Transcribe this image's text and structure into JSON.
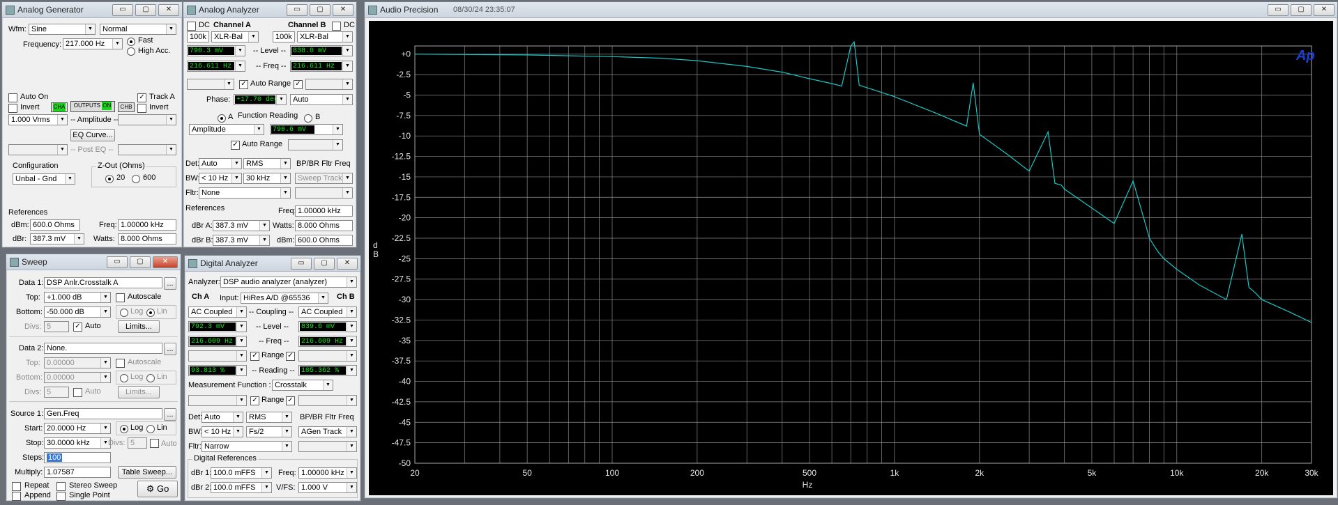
{
  "gen": {
    "title": "Analog Generator",
    "wfm_label": "Wfm:",
    "wfm": "Sine",
    "mode": "Normal",
    "freq_label": "Frequency:",
    "freq": "217.000  Hz",
    "fast": "Fast",
    "high_acc": "High Acc.",
    "auto_on": "Auto On",
    "invert": "Invert",
    "track_a": "Track A",
    "invert_b": "Invert",
    "cha": "CHA",
    "outputs": "OUTPUTS",
    "on": "ON",
    "chb": "CHB",
    "amp_val": "1.000    Vrms",
    "amp_label": "-- Amplitude --",
    "eq_curve": "EQ Curve...",
    "post_eq": "-- Post EQ --",
    "config_label": "Configuration",
    "config": "Unbal - Gnd",
    "zout_label": "Z-Out (Ohms)",
    "z20": "20",
    "z600": "600",
    "refs": "References",
    "dbm_label": "dBm:",
    "dbm": "600.0    Ohms",
    "dbr_label": "dBr:",
    "dbr": "387.3   mV",
    "freq_ref_label": "Freq:",
    "freq_ref": "1.00000 kHz",
    "watts_label": "Watts:",
    "watts": "8.000    Ohms"
  },
  "ana": {
    "title": "Analog Analyzer",
    "dc": "DC",
    "cha": "Channel A",
    "chb": "Channel B",
    "dc2": "DC",
    "za": "100k",
    "ina": "XLR-Bal",
    "zb": "100k",
    "inb": "XLR-Bal",
    "lev_a": "790.3   mV",
    "lev_label": "-- Level --",
    "lev_b": "838.0   mV",
    "freq_a": "216.611  Hz",
    "freq_label": "-- Freq --",
    "freq_b": "216.611  Hz",
    "auto_range": "Auto Range",
    "phase_label": "Phase:",
    "phase": "+17.70  deg",
    "phase_mode": "Auto",
    "fr_a": "A",
    "fr_label": "Function Reading",
    "fr_b": "B",
    "fn": "Amplitude",
    "fn_val": "790.6   mV",
    "auto_range2": "Auto Range",
    "det_label": "Det:",
    "det": "Auto",
    "rms": "RMS",
    "bp": "BP/BR Fltr Freq",
    "bw_label": "BW:",
    "bw": "< 10 Hz",
    "bw2": "30 kHz",
    "sweep_track": "Sweep Track",
    "fltr_label": "Fltr:",
    "fltr": "None",
    "refs": "References",
    "freq_ref_label": "Freq:",
    "freq_ref": "1.00000 kHz",
    "dbra_label": "dBr A:",
    "dbra": "387.3   mV",
    "watts_label": "Watts:",
    "watts": "8.000    Ohms",
    "dbrb_label": "dBr B:",
    "dbrb": "387.3   mV",
    "dbm_label": "dBm:",
    "dbm": "600.0    Ohms"
  },
  "sweep": {
    "title": "Sweep",
    "data1_label": "Data 1:",
    "data1": "DSP Anlr.Crosstalk A",
    "top_label": "Top:",
    "top": "+1.000   dB",
    "autoscale": "Autoscale",
    "bottom_label": "Bottom:",
    "bottom": "-50.000  dB",
    "log": "Log",
    "lin": "Lin",
    "divs_label": "Divs:",
    "divs": "5",
    "auto": "Auto",
    "limits": "Limits...",
    "data2_label": "Data 2:",
    "data2": "None.",
    "top2": "0.00000",
    "bottom2": "0.00000",
    "divs2": "5",
    "limits2": "Limits...",
    "source_label": "Source 1:",
    "source": "Gen.Freq",
    "start_label": "Start:",
    "start": "20.0000  Hz",
    "stop_label": "Stop:",
    "stop": "30.0000 kHz",
    "divs3": "5",
    "steps_label": "Steps:",
    "steps": "100",
    "multiply_label": "Multiply:",
    "multiply": "1.07587",
    "table_sweep": "Table Sweep...",
    "repeat": "Repeat",
    "stereo": "Stereo Sweep",
    "append": "Append",
    "single": "Single Point",
    "go": "Go"
  },
  "dig": {
    "title": "Digital Analyzer",
    "analyzer_label": "Analyzer:",
    "analyzer": "DSP audio analyzer (analyzer)",
    "cha": "Ch A",
    "input_label": "Input:",
    "input": "HiRes A/D @65536",
    "chb": "Ch B",
    "coup_a": "AC Coupled",
    "coup_label": "-- Coupling --",
    "coup_b": "AC Coupled",
    "lev_a": "792.3   mV",
    "lev_label": "-- Level --",
    "lev_b": "839.6   mV",
    "freq_a": "216.609  Hz",
    "freq_label": "-- Freq --",
    "freq_b": "216.609  Hz",
    "range": "Range",
    "read_a": "93.813   %",
    "read_label": "-- Reading --",
    "read_b": "105.362  %",
    "mf_label": "Measurement Function :",
    "mf": "Crosstalk",
    "range2": "Range",
    "det_label": "Det:",
    "det": "Auto",
    "rms": "RMS",
    "bp": "BP/BR Fltr Freq",
    "bw_label": "BW:",
    "bw": "< 10 Hz",
    "bw2": "Fs/2",
    "agen": "AGen Track",
    "fltr_label": "Fltr:",
    "fltr": "Narrow",
    "dref": "Digital References",
    "dbr1_label": "dBr 1:",
    "dbr1": "100.0   mFFS",
    "freq_label2": "Freq:",
    "freq_ref": "1.00000 kHz",
    "dbr2_label": "dBr 2:",
    "dbr2": "100.0   mFFS",
    "vfs_label": "V/FS:",
    "vfs": "1.000    V"
  },
  "plot": {
    "title": "Audio Precision",
    "timestamp": "08/30/24 23:35:07",
    "logo": "Ap"
  },
  "chart_data": {
    "type": "line",
    "xlabel": "Hz",
    "ylabel": "d\nB",
    "xscale": "log",
    "xlim": [
      20,
      30000
    ],
    "ylim": [
      -50,
      1
    ],
    "x_tick_labels": [
      "20",
      "50",
      "100",
      "200",
      "500",
      "1k",
      "2k",
      "5k",
      "10k",
      "20k",
      "30k"
    ],
    "x_ticks": [
      20,
      50,
      100,
      200,
      500,
      1000,
      2000,
      5000,
      10000,
      20000,
      30000
    ],
    "y_tick_labels": [
      "+0",
      "-2.5",
      "-5",
      "-7.5",
      "-10",
      "-12.5",
      "-15",
      "-17.5",
      "-20",
      "-22.5",
      "-25",
      "-27.5",
      "-30",
      "-32.5",
      "-35",
      "-37.5",
      "-40",
      "-42.5",
      "-45",
      "-47.5",
      "-50"
    ],
    "y_ticks": [
      0,
      -2.5,
      -5,
      -7.5,
      -10,
      -12.5,
      -15,
      -17.5,
      -20,
      -22.5,
      -25,
      -27.5,
      -30,
      -32.5,
      -35,
      -37.5,
      -40,
      -42.5,
      -45,
      -47.5,
      -50
    ],
    "grid": true,
    "color": "#18c8c8",
    "series": [
      {
        "x": [
          20,
          50,
          100,
          150,
          200,
          300,
          400,
          500,
          600,
          650,
          700,
          720,
          750,
          800,
          1000,
          1400,
          1800,
          1900,
          2000,
          2500,
          3000,
          3500,
          3700,
          3900,
          4000,
          5000,
          6000,
          7000,
          8000,
          8300,
          8600,
          9000,
          10000,
          12000,
          15000,
          17000,
          18000,
          19000,
          20000,
          25000,
          30000
        ],
        "y": [
          0,
          -0.1,
          -0.3,
          -0.5,
          -0.8,
          -1.5,
          -2.2,
          -3,
          -3.6,
          -3.9,
          1,
          1.5,
          -3.8,
          -4.1,
          -5.2,
          -7.2,
          -8.8,
          -3.5,
          -9.8,
          -12.2,
          -14.3,
          -9.5,
          -15.8,
          -16,
          -16.5,
          -18.8,
          -20.7,
          -15.5,
          -22.5,
          -23.4,
          -24.2,
          -25,
          -26.3,
          -28.2,
          -30,
          -22,
          -28.5,
          -29.2,
          -30,
          -31.5,
          -32.8
        ]
      }
    ]
  }
}
